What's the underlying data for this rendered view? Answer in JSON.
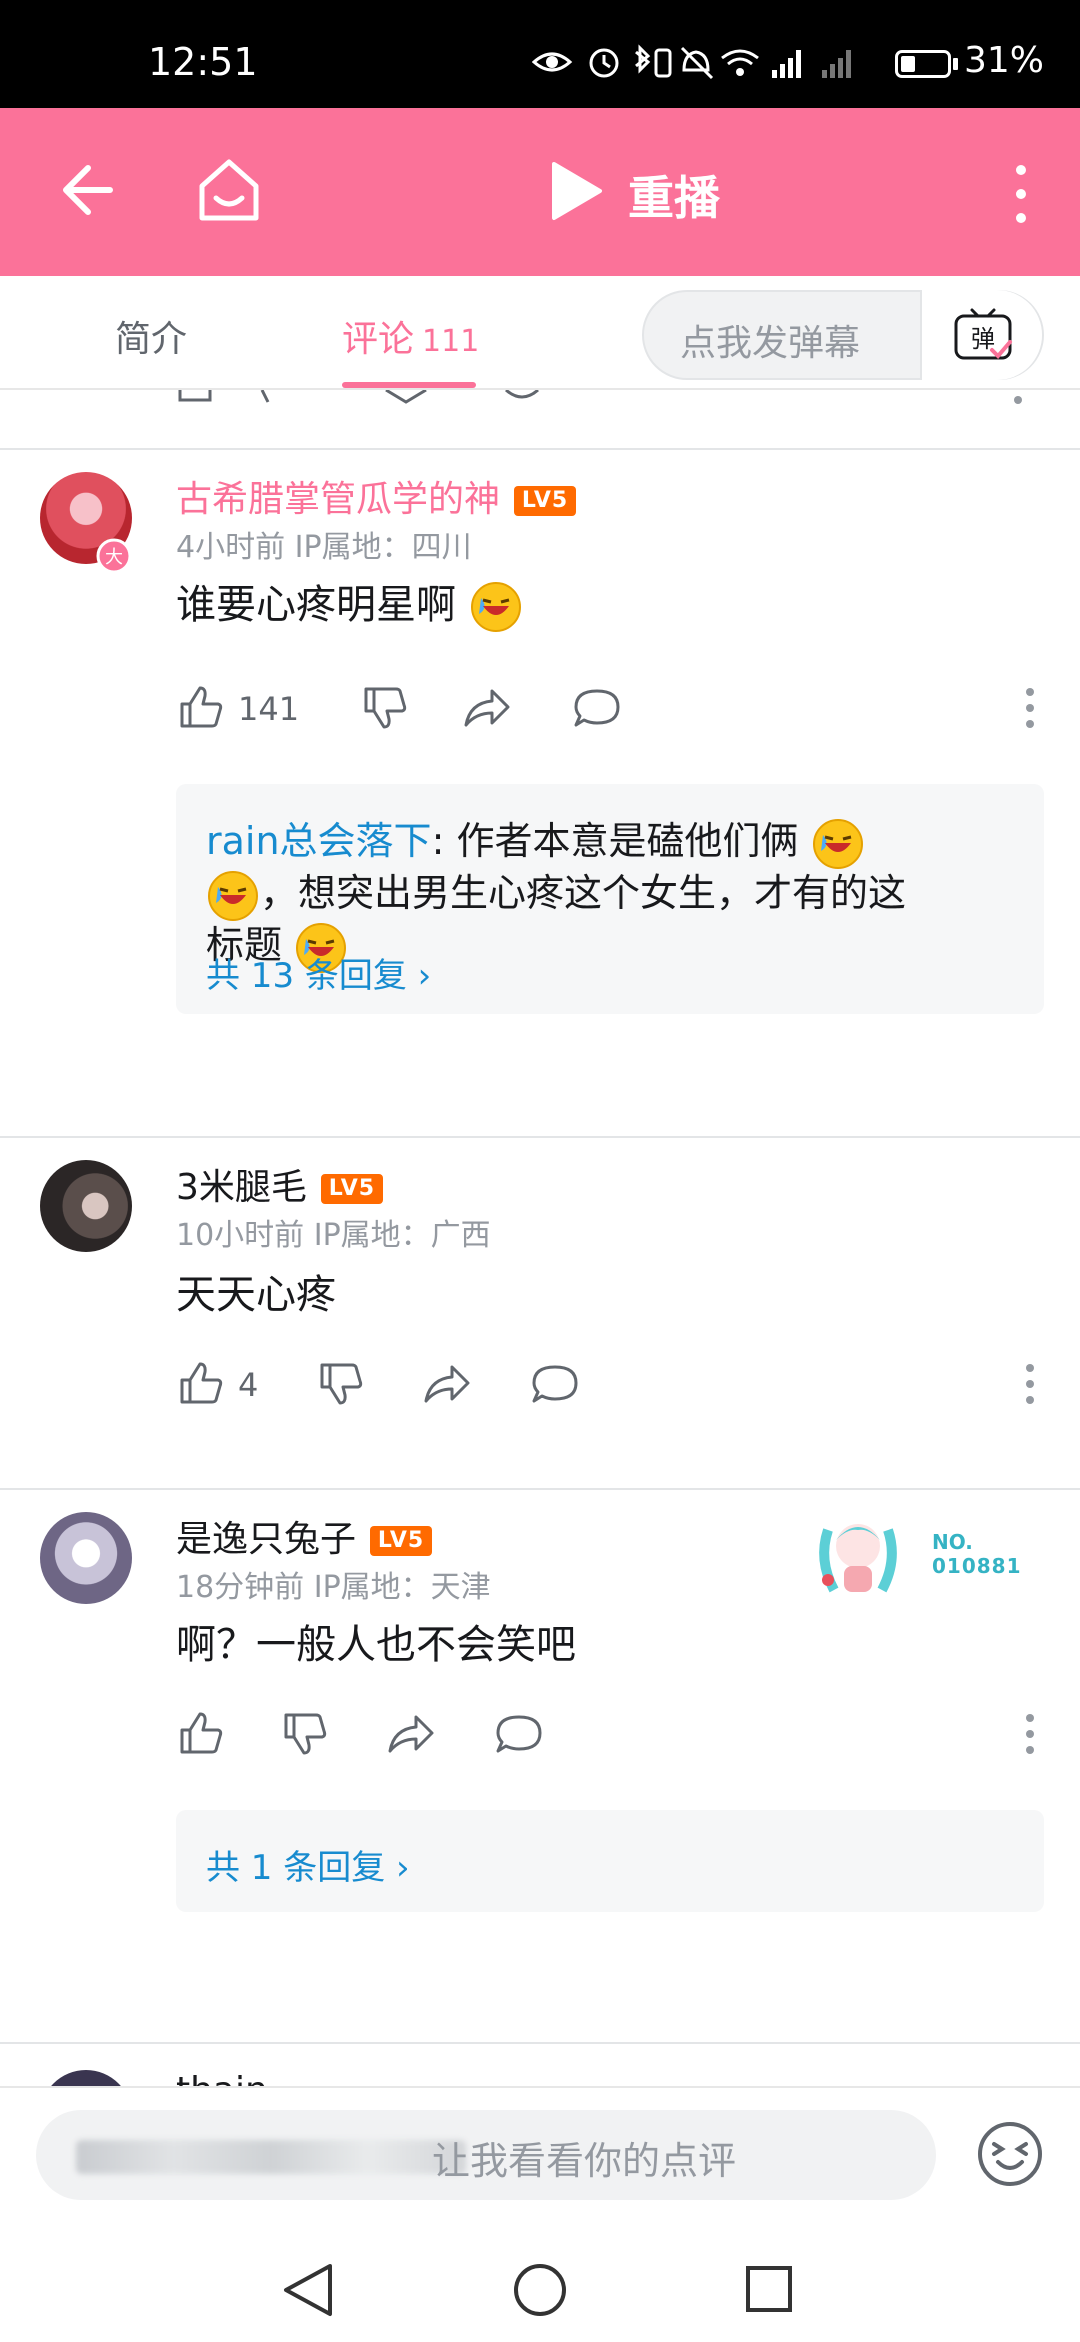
{
  "status_bar": {
    "time": "12:51",
    "battery": "31%"
  },
  "header": {
    "title": "重播"
  },
  "tabs": [
    {
      "label": "简介",
      "count": ""
    },
    {
      "label": "评论",
      "count": "111"
    }
  ],
  "danmaku": {
    "placeholder": "点我发弹幕",
    "button_label": "弹"
  },
  "comments": [
    {
      "username": "古希腊掌管瓜学的神",
      "level": "LV5",
      "time": "4小时前",
      "location": "IP属地：四川",
      "text": "谁要心疼明星啊",
      "likes": "141",
      "reply": {
        "user": "rain总会落下",
        "line1": "作者本意是磕他们俩",
        "line2": "，想突出男生心疼这个女生，才有的这",
        "line3": "标题"
      },
      "reply_more": "共 13 条回复 ›"
    },
    {
      "username": "3米腿毛",
      "level": "LV5",
      "time": "10小时前",
      "location": "IP属地：广西",
      "text": "天天心疼",
      "likes": "4"
    },
    {
      "username": "是逸只兔子",
      "level": "LV5",
      "time": "18分钟前",
      "location": "IP属地：天津",
      "text": "啊？一般人也不会笑吧",
      "likes": "",
      "badge_no": "NO.",
      "badge_num": "010881",
      "reply_more": "共 1 条回复 ›"
    }
  ],
  "next_comment_peek": "thain",
  "bottom_input": {
    "placeholder": "让我看看你的点评"
  },
  "colors": {
    "brand_pink": "#fb7299",
    "link_blue": "#178bcf",
    "level_orange": "#ff6a00"
  }
}
